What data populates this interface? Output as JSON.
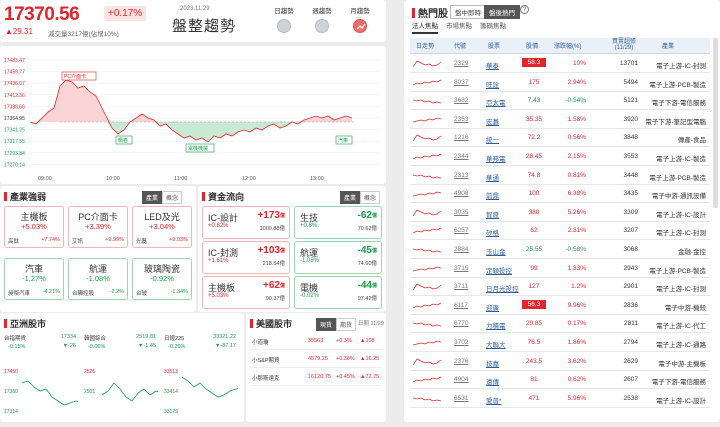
{
  "header": {
    "index_value": "17370.56",
    "index_pct": "+0.17%",
    "index_change": "▲29.31",
    "volume_text": "減交量3217億(佔增10%)",
    "date": "2023.11.29",
    "title": "盤整趨勢",
    "trends": [
      {
        "label": "日趨勢",
        "active": false
      },
      {
        "label": "週趨勢",
        "active": false
      },
      {
        "label": "月趨勢",
        "active": true
      }
    ]
  },
  "main_chart": {
    "y_ticks": [
      "17483.47",
      "17459.77",
      "17436.07",
      "17412.36",
      "17388.66",
      "17364.95",
      "17341.25",
      "17317.55",
      "17293.84",
      "17270.14"
    ],
    "x_ticks": [
      "09:00",
      "10:00",
      "11:00",
      "12:00",
      "13:00"
    ],
    "annotations": [
      "PC介面卡",
      "鋼卷",
      "電機機械",
      "汽車"
    ]
  },
  "industry": {
    "title": "產業強弱",
    "tabs": [
      "產業",
      "概念"
    ],
    "cells": [
      {
        "name": "主機板",
        "pct": "+5.03%",
        "sub_name": "高鈦",
        "sub_pct": "+7.74%",
        "color": "up"
      },
      {
        "name": "PC介面卡",
        "pct": "+3.39%",
        "sub_name": "艾訊",
        "sub_pct": "+9.99%",
        "color": "up"
      },
      {
        "name": "LED及光",
        "pct": "+3.04%",
        "sub_name": "光磊",
        "sub_pct": "+9.03%",
        "color": "up"
      },
      {
        "name": "汽車",
        "pct": "-1.27%",
        "sub_name": "昶傑汽車",
        "sub_pct": "-4.21%",
        "color": "dn"
      },
      {
        "name": "航運",
        "pct": "-1.08%",
        "sub_name": "台驊控股",
        "sub_pct": "-2.2%",
        "color": "dn"
      },
      {
        "name": "玻璃陶瓷",
        "pct": "-0.92%",
        "sub_name": "台玻",
        "sub_pct": "-1.34%",
        "color": "dn"
      }
    ]
  },
  "flow": {
    "title": "資金流向",
    "tabs": [
      "產業",
      "概念"
    ],
    "cells": [
      {
        "name": "IC-設計",
        "pct": "+0.82%",
        "amt": "+173",
        "unit": "億",
        "total": "1000.88億",
        "color": "up"
      },
      {
        "name": "生技",
        "pct": "+0.8%",
        "amt": "-62",
        "unit": "億",
        "total": "70.62億",
        "color": "dn"
      },
      {
        "name": "IC-封測",
        "pct": "+1.61%",
        "amt": "+103",
        "unit": "億",
        "total": "218.54億",
        "color": "up"
      },
      {
        "name": "航運",
        "pct": "-1.08%",
        "amt": "-45",
        "unit": "億",
        "total": "74.60億",
        "color": "dn"
      },
      {
        "name": "主機板",
        "pct": "+5.03%",
        "amt": "+62",
        "unit": "億",
        "total": "90.37億",
        "color": "up"
      },
      {
        "name": "電機",
        "pct": "-0.02%",
        "amt": "-44",
        "unit": "億",
        "total": "97.42億",
        "color": "dn"
      }
    ]
  },
  "asia": {
    "title": "亞洲股市",
    "markets": [
      {
        "name": "台指期貨",
        "value": "17334",
        "pct": "-0.15%",
        "chg": "▼-26",
        "color": "dn",
        "ticks": [
          "17450",
          "17360",
          "17314"
        ]
      },
      {
        "name": "韓國綜合",
        "value": "2519.81",
        "pct": "-0.06%",
        "chg": "▼-1.45",
        "color": "dn",
        "ticks": [
          "2526",
          "2501"
        ]
      },
      {
        "name": "日經225",
        "value": "33321.22",
        "pct": "-0.26%",
        "chg": "▼-87.17",
        "color": "dn",
        "ticks": [
          "33513",
          "33414",
          "33179"
        ]
      }
    ]
  },
  "us": {
    "title": "美國股市",
    "tabs": [
      "現貨",
      "期貨"
    ],
    "date": "日期 11/29",
    "rows": [
      {
        "name": "小道瓊",
        "value": "35563",
        "pct": "+0.3%",
        "chg": "▲108",
        "color": "up"
      },
      {
        "name": "小S&P期貨",
        "value": "4579.25",
        "pct": "+0.36%",
        "chg": "▲16.25",
        "color": "up"
      },
      {
        "name": "小那斯達克",
        "value": "16120.75",
        "pct": "+0.45%",
        "chg": "▲72.75",
        "color": "up"
      }
    ]
  },
  "hot": {
    "title": "熱門股",
    "buttons": [
      {
        "label": "盤中即時",
        "active": false
      },
      {
        "label": "盤後熱門",
        "active": true
      }
    ],
    "help_icon": "question-icon",
    "tabs": [
      {
        "label": "法人焦點",
        "active": true
      },
      {
        "label": "市場焦點",
        "active": false
      },
      {
        "label": "籌碼焦點",
        "active": false
      }
    ],
    "columns": [
      "日走勢",
      "代號",
      "股票",
      "股價",
      "漲跌幅(%)",
      "買賣超張\n(11/29)",
      "產業"
    ],
    "rows": [
      {
        "code": "2329",
        "name": "華泰",
        "price": "58.3",
        "pct": "10%",
        "vol": "13701",
        "sector": "電子上游-IC-封測",
        "hl": true,
        "color": "up"
      },
      {
        "code": "8037",
        "name": "旺詮",
        "price": "175",
        "pct": "2.94%",
        "vol": "5494",
        "sector": "電子上游-PCB-製造",
        "hl": false,
        "color": "up"
      },
      {
        "code": "3682",
        "name": "亞太電",
        "price": "7.43",
        "pct": "-0.54%",
        "vol": "5121",
        "sector": "電子下游-電信服務",
        "hl": false,
        "color": "dn"
      },
      {
        "code": "2353",
        "name": "宏碁",
        "price": "35.35",
        "pct": "1.58%",
        "vol": "3920",
        "sector": "電子下游-筆記型電腦",
        "hl": false,
        "color": "up"
      },
      {
        "code": "1216",
        "name": "統一",
        "price": "72.2",
        "pct": "0.56%",
        "vol": "3848",
        "sector": "傳產-食品",
        "hl": false,
        "color": "up"
      },
      {
        "code": "2344",
        "name": "華邦電",
        "price": "28.45",
        "pct": "2.15%",
        "vol": "3553",
        "sector": "電子上游-IC-製造",
        "hl": false,
        "color": "up"
      },
      {
        "code": "2313",
        "name": "華通",
        "price": "74.8",
        "pct": "0.81%",
        "vol": "3448",
        "sector": "電子上游-PCB-製造",
        "hl": false,
        "color": "up"
      },
      {
        "code": "4908",
        "name": "前鼎",
        "price": "100",
        "pct": "6.38%",
        "vol": "3435",
        "sector": "電子中游-通訊設備",
        "hl": false,
        "color": "up"
      },
      {
        "code": "3035",
        "name": "智原",
        "price": "380",
        "pct": "5.26%",
        "vol": "3309",
        "sector": "電子上游-IC-設計",
        "hl": false,
        "color": "up"
      },
      {
        "code": "6257",
        "name": "矽格",
        "price": "62",
        "pct": "2.31%",
        "vol": "3207",
        "sector": "電子上游-IC-封測",
        "hl": false,
        "color": "up"
      },
      {
        "code": "2884",
        "name": "玉山金",
        "price": "25.55",
        "pct": "-0.58%",
        "vol": "3068",
        "sector": "金融-金控",
        "hl": false,
        "color": "dn"
      },
      {
        "code": "3715",
        "name": "定穎投控",
        "price": "99",
        "pct": "1.33%",
        "vol": "2943",
        "sector": "電子上游-PCB-製造",
        "hl": false,
        "color": "up"
      },
      {
        "code": "3711",
        "name": "日月光投控",
        "price": "127",
        "pct": "1.2%",
        "vol": "2901",
        "sector": "電子上游-IC-封測",
        "hl": false,
        "color": "up"
      },
      {
        "code": "6117",
        "name": "迎廣",
        "price": "56.3",
        "pct": "9.96%",
        "vol": "2836",
        "sector": "電子中游-機殼",
        "hl": true,
        "color": "up"
      },
      {
        "code": "6770",
        "name": "力積電",
        "price": "29.85",
        "pct": "0.17%",
        "vol": "2811",
        "sector": "電子上游-IC-代工",
        "hl": false,
        "color": "up"
      },
      {
        "code": "3702",
        "name": "大聯大",
        "price": "76.5",
        "pct": "1.86%",
        "vol": "2794",
        "sector": "電子上游-IC-通路",
        "hl": false,
        "color": "up"
      },
      {
        "code": "2376",
        "name": "技嘉",
        "price": "243.5",
        "pct": "3.62%",
        "vol": "2629",
        "sector": "電子中游-主機板",
        "hl": false,
        "color": "up"
      },
      {
        "code": "4904",
        "name": "遠傳",
        "price": "81",
        "pct": "0.62%",
        "vol": "2607",
        "sector": "電子下游-電信服務",
        "hl": false,
        "color": "up"
      },
      {
        "code": "6531",
        "name": "愛普*",
        "price": "471",
        "pct": "5.96%",
        "vol": "2538",
        "sector": "電子上游-IC-設計",
        "hl": false,
        "color": "up"
      }
    ]
  }
}
